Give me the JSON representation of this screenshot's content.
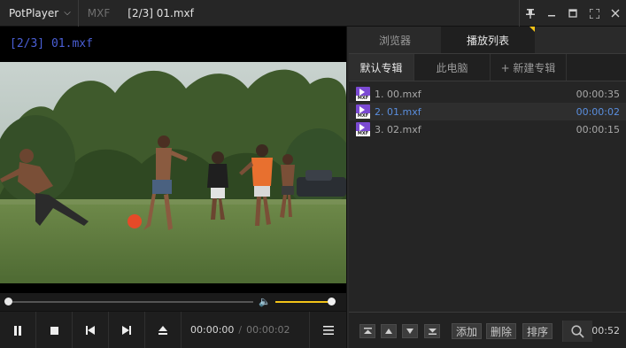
{
  "titlebar": {
    "app_name": "PotPlayer",
    "format": "MXF",
    "title": "[2/3] 01.mxf",
    "icons": [
      "chevron-down-icon",
      "pin-icon",
      "minimize-icon",
      "maximize-icon",
      "fullscreen-icon",
      "close-icon"
    ]
  },
  "video": {
    "osd_text": "[2/3] 01.mxf",
    "seek_progress": 0.0,
    "volume_level": 0.94
  },
  "controls": {
    "current_time": "00:00:00",
    "separator": "/",
    "total_time": "00:00:02"
  },
  "panel": {
    "tabs": [
      {
        "label": "浏览器",
        "active": false
      },
      {
        "label": "播放列表",
        "active": true
      }
    ],
    "subtabs": [
      {
        "label": "默认专辑",
        "active": true
      },
      {
        "label": "此电脑",
        "active": false
      },
      {
        "label": "+ 新建专辑",
        "active": false
      }
    ],
    "playlist": [
      {
        "name": "1. 00.mxf",
        "duration": "00:00:35",
        "current": false
      },
      {
        "name": "2. 01.mxf",
        "duration": "00:00:02",
        "current": true
      },
      {
        "name": "3. 02.mxf",
        "duration": "00:00:15",
        "current": false
      }
    ],
    "file_icon_caption": "MXF",
    "buttons": {
      "add": "添加",
      "delete": "删除",
      "sort": "排序"
    },
    "total_duration": "00:52"
  },
  "colors": {
    "accent_yellow": "#f2c318",
    "current_item_blue": "#5a8ede",
    "osd_blue": "#4a5fd6",
    "file_icon_purple": "#7b4ad3"
  }
}
